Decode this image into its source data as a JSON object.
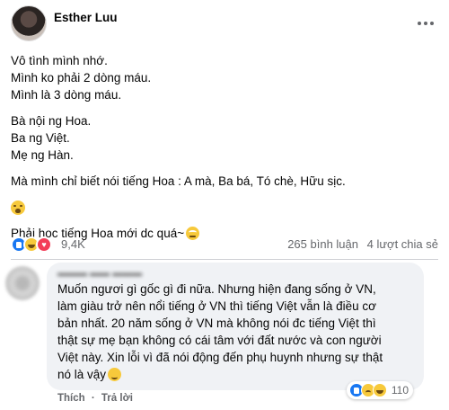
{
  "post": {
    "author": "Esther Luu",
    "paragraphs": [
      [
        "Vô tình mình nhớ.",
        "Mình ko phải 2 dòng máu.",
        "Mình là 3 dòng máu."
      ],
      [
        "Bà nội ng Hoa.",
        "Ba ng Việt.",
        "Mẹ ng Hàn."
      ],
      [
        "Mà mình chỉ biết nói tiếng Hoa : A mà, Ba bá, Tó chè, Hữu sịc."
      ]
    ],
    "last_line": "Phải học tiếng Hoa mới dc quá~",
    "icons": {
      "emoji_1": "sob-emoji",
      "emoji_2": "face-rolling-eyes-emoji",
      "more": "more-options-icon"
    }
  },
  "stats": {
    "reactions": [
      "like",
      "haha",
      "love"
    ],
    "reaction_count": "9,4K",
    "comments": "265 bình luận",
    "shares": "4 lượt chia sẻ"
  },
  "comment": {
    "lines": [
      "Muốn ngươi gì gốc gì đi nữa. Nhưng hiện đang sống ở VN,",
      "làm giàu trở nên nổi tiếng ở VN thì tiếng Việt vẫn là điều cơ",
      "bản nhất. 20 năm sống ở VN mà không nói đc tiếng Việt thì",
      "thật sự mẹ bạn không có cái tâm với đất nước và con người",
      "Việt này. Xin lỗi vì đã nói động đến phụ huynh nhưng sự thật",
      "nó là vậy"
    ],
    "reactions": [
      "like",
      "sad",
      "haha"
    ],
    "reaction_count": "110",
    "actions": {
      "like": "Thích",
      "sep": "·",
      "reply": "Trả lời"
    }
  }
}
